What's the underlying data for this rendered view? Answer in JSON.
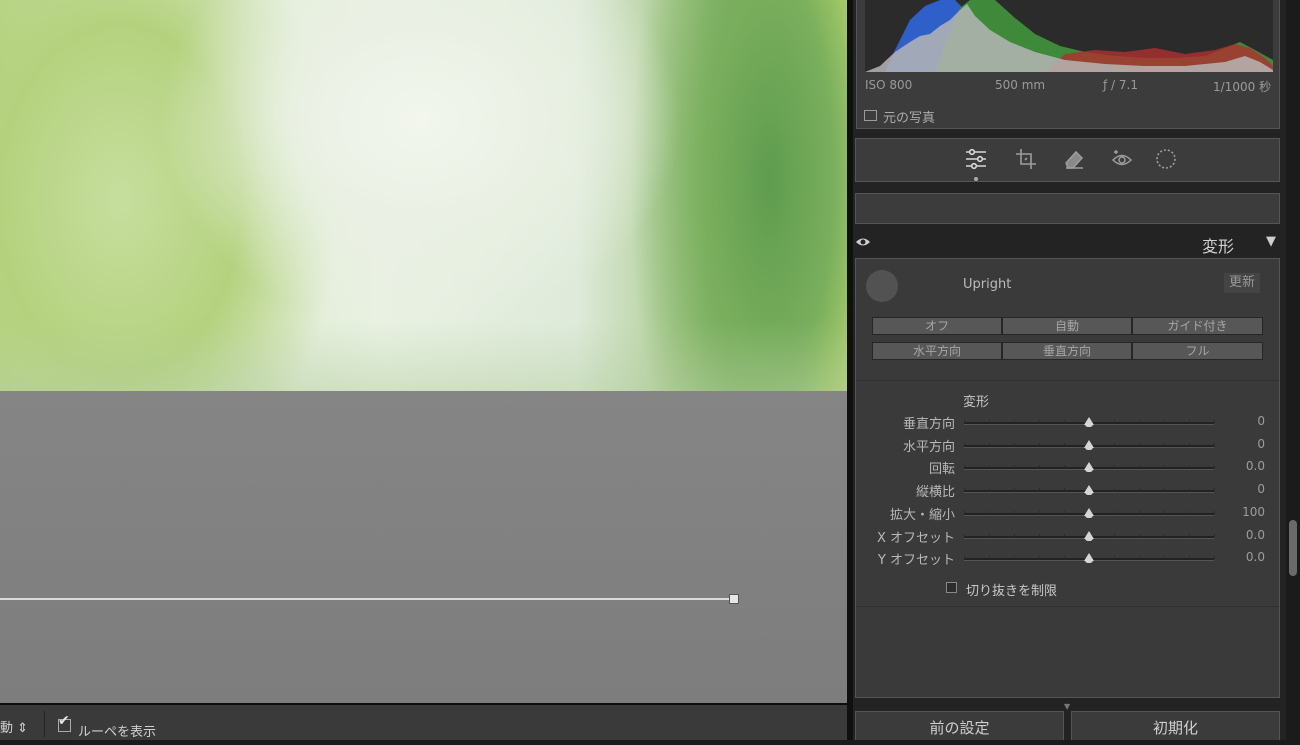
{
  "toolbar": {
    "move_label": "動 ⇕",
    "loupe_label": "ルーペを表示",
    "loupe_checked": true
  },
  "histogram": {
    "iso": "ISO 800",
    "focal": "500 mm",
    "aperture": "ƒ / 7.1",
    "shutter": "1/1000 秒",
    "original_label": "元の写真"
  },
  "tools": [
    {
      "name": "edit-sliders-icon",
      "active": true
    },
    {
      "name": "crop-icon",
      "active": false
    },
    {
      "name": "eraser-icon",
      "active": false
    },
    {
      "name": "redeye-icon",
      "active": false
    },
    {
      "name": "mask-icon",
      "active": false
    }
  ],
  "section": {
    "title": "変形"
  },
  "upright": {
    "label": "Upright",
    "update_label": "更新",
    "buttons": [
      "オフ",
      "自動",
      "ガイド付き",
      "水平方向",
      "垂直方向",
      "フル"
    ]
  },
  "transform": {
    "title": "変形",
    "sliders": [
      {
        "label": "垂直方向",
        "value": "0",
        "pos": 0.5
      },
      {
        "label": "水平方向",
        "value": "0",
        "pos": 0.5
      },
      {
        "label": "回転",
        "value": "0.0",
        "pos": 0.5
      },
      {
        "label": "縦横比",
        "value": "0",
        "pos": 0.5
      },
      {
        "label": "拡大・縮小",
        "value": "100",
        "pos": 0.5
      },
      {
        "label": "X オフセット",
        "value": "0.0",
        "pos": 0.5
      },
      {
        "label": "Y オフセット",
        "value": "0.0",
        "pos": 0.5
      }
    ],
    "constrain_label": "切り抜きを制限",
    "constrain_checked": false
  },
  "bottom": {
    "previous_label": "前の設定",
    "reset_label": "初期化"
  },
  "colors": {
    "panel": "#3a3a3a",
    "background": "#232323",
    "accent": "#d6d6d6"
  }
}
